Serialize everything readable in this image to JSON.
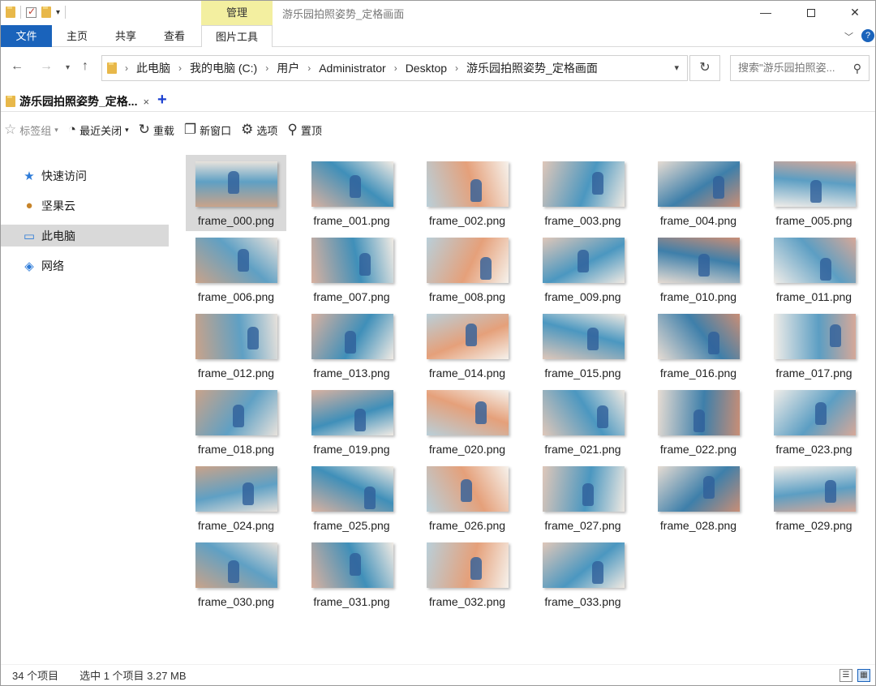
{
  "window": {
    "title": "游乐园拍照姿势_定格画面",
    "manage_tab": "管理"
  },
  "ribbon": {
    "tabs": [
      "文件",
      "主页",
      "共享",
      "查看",
      "图片工具"
    ]
  },
  "nav": {
    "crumbs": [
      "此电脑",
      "我的电脑 (C:)",
      "用户",
      "Administrator",
      "Desktop",
      "游乐园拍照姿势_定格画面"
    ],
    "search_placeholder": "搜索\"游乐园拍照姿..."
  },
  "doc_tab": {
    "label": "游乐园拍照姿势_定格...",
    "close": "×",
    "add": "+"
  },
  "toolbar": {
    "bookmark_group": "标签组",
    "recently_closed": "最近关闭",
    "reload": "重载",
    "new_window": "新窗口",
    "options": "选项",
    "pin": "置顶"
  },
  "sidebar": {
    "items": [
      {
        "label": "快速访问",
        "icon": "star-icon"
      },
      {
        "label": "坚果云",
        "icon": "nut-cloud-icon"
      },
      {
        "label": "此电脑",
        "icon": "computer-icon"
      },
      {
        "label": "网络",
        "icon": "network-icon"
      }
    ]
  },
  "files": [
    "frame_000.png",
    "frame_001.png",
    "frame_002.png",
    "frame_003.png",
    "frame_004.png",
    "frame_005.png",
    "frame_006.png",
    "frame_007.png",
    "frame_008.png",
    "frame_009.png",
    "frame_010.png",
    "frame_011.png",
    "frame_012.png",
    "frame_013.png",
    "frame_014.png",
    "frame_015.png",
    "frame_016.png",
    "frame_017.png",
    "frame_018.png",
    "frame_019.png",
    "frame_020.png",
    "frame_021.png",
    "frame_022.png",
    "frame_023.png",
    "frame_024.png",
    "frame_025.png",
    "frame_026.png",
    "frame_027.png",
    "frame_028.png",
    "frame_029.png",
    "frame_030.png",
    "frame_031.png",
    "frame_032.png",
    "frame_033.png"
  ],
  "status": {
    "count": "34 个项目",
    "selection": "选中 1 个项目  3.27 MB"
  },
  "colors": {
    "accent": "#1a63bb",
    "manage": "#f3efa0",
    "selection": "#d9d9d9"
  }
}
